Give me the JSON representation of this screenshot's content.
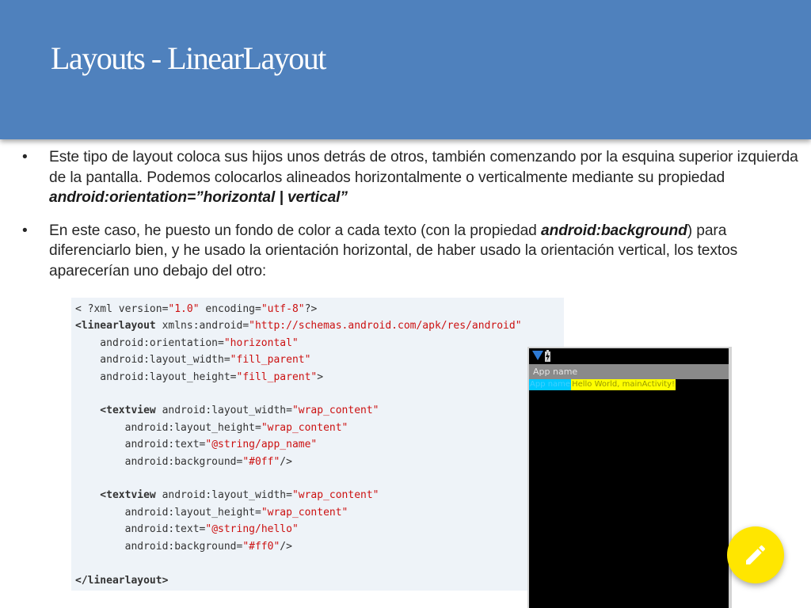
{
  "slide": {
    "title": "Layouts - LinearLayout",
    "bullet_glyph": "•",
    "bullets": [
      {
        "parts": [
          "Este tipo de layout coloca sus hijos unos detrás de otros, también comenzando por la esquina superior izquierda de la pantalla. Podemos colocarlos alineados horizontalmente o verticalmente mediante su propiedad ",
          "android:orientation=”horizontal | vertical”"
        ]
      },
      {
        "parts": [
          "En este caso, he puesto un fondo de color a cada texto (con la propiedad ",
          "android:background",
          ") para diferenciarlo bien, y he usado la orientación horizontal, de haber usado la orientación vertical, los textos aparecerían uno debajo del otro:"
        ]
      }
    ]
  },
  "code": {
    "lines": [
      [
        [
          "t",
          "< ?xml version="
        ],
        [
          "v",
          "\"1.0\""
        ],
        [
          "t",
          " encoding="
        ],
        [
          "v",
          "\"utf-8\""
        ],
        [
          "t",
          "?>"
        ]
      ],
      [
        [
          "b",
          "<linearlayout"
        ],
        [
          "t",
          " xmlns:android="
        ],
        [
          "v",
          "\"http://schemas.android.com/apk/res/android\""
        ]
      ],
      [
        [
          "t",
          "    android:orientation="
        ],
        [
          "v",
          "\"horizontal\""
        ]
      ],
      [
        [
          "t",
          "    android:layout_width="
        ],
        [
          "v",
          "\"fill_parent\""
        ]
      ],
      [
        [
          "t",
          "    android:layout_height="
        ],
        [
          "v",
          "\"fill_parent\""
        ],
        [
          "t",
          ">"
        ]
      ],
      [],
      [
        [
          "b",
          "    <textview"
        ],
        [
          "t",
          " android:layout_width="
        ],
        [
          "v",
          "\"wrap_content\""
        ]
      ],
      [
        [
          "t",
          "        android:layout_height="
        ],
        [
          "v",
          "\"wrap_content\""
        ]
      ],
      [
        [
          "t",
          "        android:text="
        ],
        [
          "v",
          "\"@string/app_name\""
        ]
      ],
      [
        [
          "t",
          "        android:background="
        ],
        [
          "v",
          "\"#0ff\""
        ],
        [
          "t",
          "/>"
        ]
      ],
      [],
      [
        [
          "b",
          "    <textview"
        ],
        [
          "t",
          " android:layout_width="
        ],
        [
          "v",
          "\"wrap_content\""
        ]
      ],
      [
        [
          "t",
          "        android:layout_height="
        ],
        [
          "v",
          "\"wrap_content\""
        ]
      ],
      [
        [
          "t",
          "        android:text="
        ],
        [
          "v",
          "\"@string/hello\""
        ]
      ],
      [
        [
          "t",
          "        android:background="
        ],
        [
          "v",
          "\"#ff0\""
        ],
        [
          "t",
          "/>"
        ]
      ],
      [],
      [
        [
          "b",
          "</linearlayout>"
        ]
      ]
    ]
  },
  "phone": {
    "app_title": "App name",
    "textviews": [
      {
        "text": "App name",
        "background": "#00c8ff",
        "color": "#40d0ff"
      },
      {
        "text": "Hello World, mainActivity!",
        "background": "#ffff00",
        "color": "#999900"
      }
    ]
  },
  "icons": {
    "fab": "pencil-icon",
    "status_signal": "signal-icon",
    "status_battery": "battery-icon"
  },
  "colors": {
    "header": "#4f81bd",
    "fab": "#ffe600",
    "code_value": "#cc1111",
    "code_background": "#eef3f8"
  }
}
